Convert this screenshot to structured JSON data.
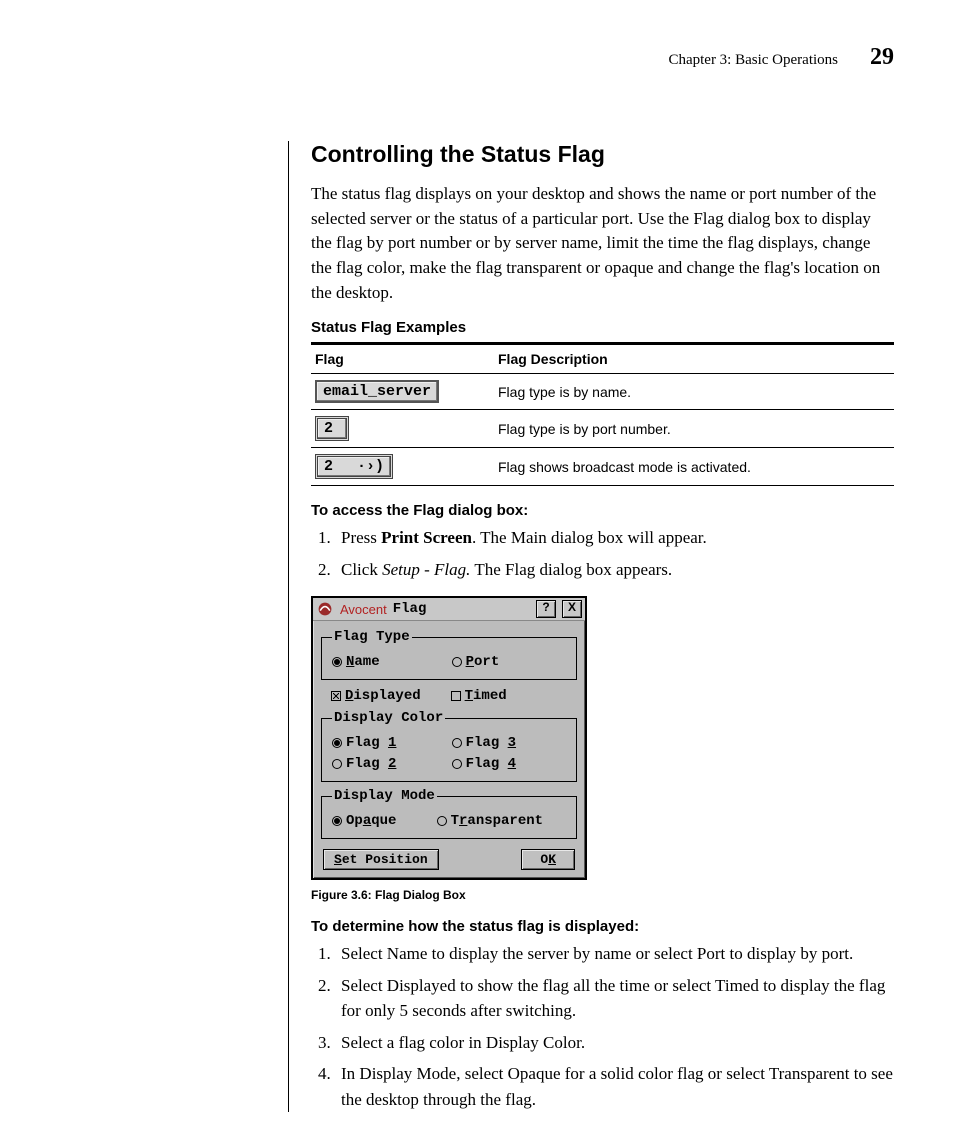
{
  "header": {
    "chapter": "Chapter 3: Basic Operations",
    "page": "29"
  },
  "h2": "Controlling the Status Flag",
  "intro": "The status flag displays on your desktop and shows the name or port number of the selected server or the status of a particular port. Use the Flag dialog box to display the flag by port number or by server name, limit the time the flag displays, change the flag color, make the flag transparent or opaque and change the flag's location on the desktop.",
  "examples_title": "Status Flag Examples",
  "table": {
    "headers": [
      "Flag",
      "Flag Description"
    ],
    "rows": [
      {
        "flag_text": "email_server",
        "desc": "Flag type is by name.",
        "broadcast": false
      },
      {
        "flag_text": "2",
        "desc": "Flag type is by port number.",
        "broadcast": false
      },
      {
        "flag_text": "2",
        "desc": "Flag shows broadcast mode is activated.",
        "broadcast": true
      }
    ]
  },
  "access_heading": "To access the Flag dialog box:",
  "access_steps": {
    "s1_pre": "Press ",
    "s1_bold": "Print Screen",
    "s1_post": ". The Main dialog box will appear.",
    "s2_pre": "Click ",
    "s2_italic": "Setup - Flag.",
    "s2_post": " The Flag dialog box appears."
  },
  "dialog": {
    "brand": "Avocent",
    "title": "Flag",
    "help": "?",
    "close": "X",
    "flag_type_legend": "Flag Type",
    "name_sel": true,
    "name_label_pre": "N",
    "name_label_post": "ame",
    "port_sel": false,
    "port_label_pre": "P",
    "port_label_post": "ort",
    "displayed_sel": true,
    "displayed_label_pre": "D",
    "displayed_label_post": "isplayed",
    "timed_sel": false,
    "timed_label_pre": "T",
    "timed_label_post": "imed",
    "color_legend": "Display Color",
    "flag1_sel": true,
    "flag1_pre": "Flag ",
    "flag1_u": "1",
    "flag2_sel": false,
    "flag2_pre": "Flag ",
    "flag2_u": "2",
    "flag3_sel": false,
    "flag3_pre": "Flag ",
    "flag3_u": "3",
    "flag4_sel": false,
    "flag4_pre": "Flag ",
    "flag4_u": "4",
    "mode_legend": "Display Mode",
    "opaque_sel": true,
    "opaque_pre": "Op",
    "opaque_u": "a",
    "opaque_post": "que",
    "transparent_sel": false,
    "trans_pre": "T",
    "trans_u": "r",
    "trans_post": "ansparent",
    "setpos_u": "S",
    "setpos_post": "et Position",
    "ok_pre": "O",
    "ok_u": "K"
  },
  "caption": "Figure 3.6: Flag Dialog Box",
  "determine_heading": "To determine how the status flag is displayed:",
  "determine_steps": [
    "Select Name to display the server by name or select Port to display by port.",
    "Select Displayed to show the flag all the time or select Timed to display the flag for only 5 seconds after switching.",
    "Select a flag color in Display Color.",
    "In Display Mode, select Opaque for a solid color flag or select Transparent to see the desktop through the flag."
  ]
}
